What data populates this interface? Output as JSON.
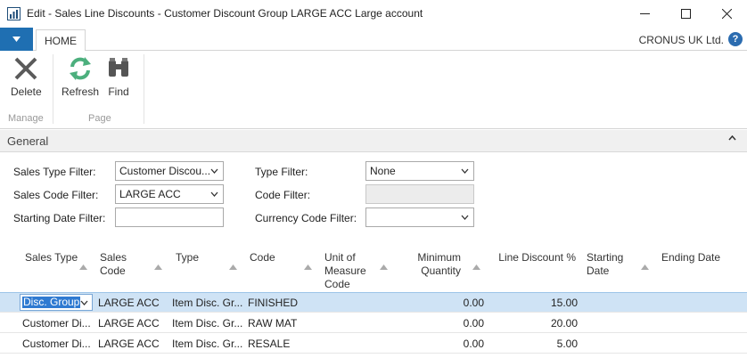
{
  "window": {
    "title": "Edit - Sales Line Discounts - Customer Discount Group LARGE ACC Large account",
    "controls": [
      "minimize-icon",
      "maximize-icon",
      "close-icon"
    ]
  },
  "ribbon": {
    "file_icon": "file-menu-chevron-icon",
    "tab_home": "HOME",
    "company": "CRONUS UK Ltd.",
    "help": "?",
    "buttons": {
      "delete": "Delete",
      "refresh": "Refresh",
      "find": "Find"
    },
    "groups": {
      "manage": "Manage",
      "page": "Page"
    }
  },
  "general": {
    "title": "General"
  },
  "filters": {
    "sales_type_label": "Sales Type Filter:",
    "sales_type_value": "Customer Discou...",
    "sales_code_label": "Sales Code Filter:",
    "sales_code_value": "LARGE ACC",
    "starting_date_label": "Starting Date Filter:",
    "starting_date_value": "",
    "type_label": "Type Filter:",
    "type_value": "None",
    "code_label": "Code Filter:",
    "code_value": "",
    "currency_label": "Currency Code Filter:",
    "currency_value": ""
  },
  "grid": {
    "columns": {
      "sales_type": "Sales Type",
      "sales_code": "Sales Code",
      "type": "Type",
      "code": "Code",
      "uom": "Unit of Measure Code",
      "min_qty": "Minimum Quantity",
      "line_disc": "Line Discount %",
      "starting_date": "Starting Date",
      "ending_date": "Ending Date"
    },
    "rows": [
      {
        "sales_type": "Disc. Group",
        "sales_code": "LARGE ACC",
        "type": "Item Disc. Gr...",
        "code": "FINISHED",
        "uom": "",
        "min_qty": "0.00",
        "line_disc": "15.00",
        "starting_date": "",
        "ending_date": ""
      },
      {
        "sales_type": "Customer Di...",
        "sales_code": "LARGE ACC",
        "type": "Item Disc. Gr...",
        "code": "RAW MAT",
        "uom": "",
        "min_qty": "0.00",
        "line_disc": "20.00",
        "starting_date": "",
        "ending_date": ""
      },
      {
        "sales_type": "Customer Di...",
        "sales_code": "LARGE ACC",
        "type": "Item Disc. Gr...",
        "code": "RESALE",
        "uom": "",
        "min_qty": "0.00",
        "line_disc": "5.00",
        "starting_date": "",
        "ending_date": ""
      }
    ]
  }
}
